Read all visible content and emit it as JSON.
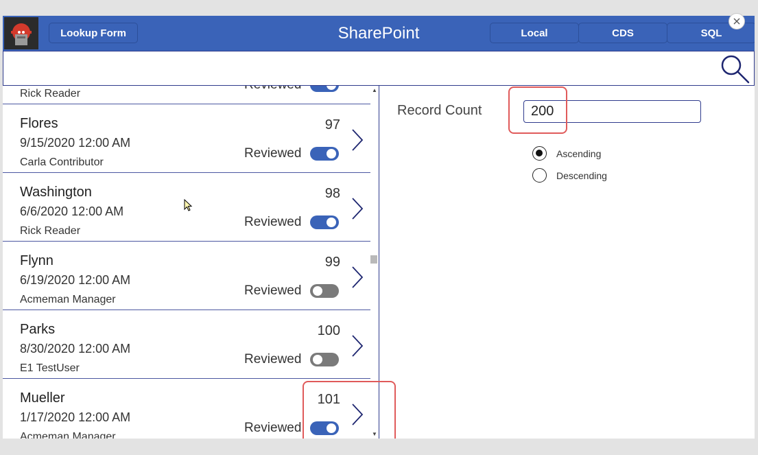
{
  "header": {
    "lookup_button": "Lookup Form",
    "title": "SharePoint",
    "source_tabs": [
      "Local",
      "CDS",
      "SQL"
    ]
  },
  "search": {
    "value": "",
    "placeholder": ""
  },
  "list": {
    "items": [
      {
        "name": "",
        "date": "",
        "user": "Rick Reader",
        "number": "",
        "reviewed_label": "Reviewed",
        "reviewed": true
      },
      {
        "name": "Flores",
        "date": "9/15/2020 12:00 AM",
        "user": "Carla Contributor",
        "number": "97",
        "reviewed_label": "Reviewed",
        "reviewed": true
      },
      {
        "name": "Washington",
        "date": "6/6/2020 12:00 AM",
        "user": "Rick Reader",
        "number": "98",
        "reviewed_label": "Reviewed",
        "reviewed": true
      },
      {
        "name": "Flynn",
        "date": "6/19/2020 12:00 AM",
        "user": "Acmeman Manager",
        "number": "99",
        "reviewed_label": "Reviewed",
        "reviewed": false
      },
      {
        "name": "Parks",
        "date": "8/30/2020 12:00 AM",
        "user": "E1 TestUser",
        "number": "100",
        "reviewed_label": "Reviewed",
        "reviewed": false
      },
      {
        "name": "Mueller",
        "date": "1/17/2020 12:00 AM",
        "user": "Acmeman Manager",
        "number": "101",
        "reviewed_label": "Reviewed",
        "reviewed": true
      }
    ]
  },
  "panel": {
    "record_count_label": "Record Count",
    "record_count_value": "200",
    "sort_options": [
      {
        "label": "Ascending",
        "selected": true
      },
      {
        "label": "Descending",
        "selected": false
      }
    ]
  },
  "colors": {
    "header_blue": "#3a63b8",
    "border_navy": "#2e3a8c",
    "toggle_on": "#3a63b8",
    "toggle_off": "#7a7a7a",
    "highlight_red": "#e05a5a"
  },
  "icons": [
    "app-logo-icon",
    "close-icon",
    "search-icon",
    "chevron-right-icon",
    "mouse-cursor-icon"
  ]
}
